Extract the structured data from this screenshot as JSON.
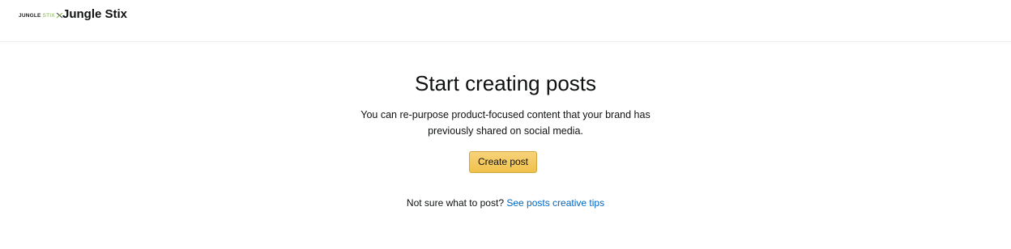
{
  "header": {
    "logo_text_jungle": "JUNGLE",
    "logo_text_stix": "STIX",
    "brand_name": "Jungle Stix"
  },
  "main": {
    "title": "Start creating posts",
    "description": "You can re-purpose product-focused content that your brand has previously shared on social media.",
    "create_post_label": "Create post",
    "tips_prompt": "Not sure what to post?",
    "tips_link_label": "See posts creative tips"
  },
  "colors": {
    "button_background": "#f0c14b",
    "link": "#0066c0",
    "logo_accent": "#7cae3f"
  }
}
